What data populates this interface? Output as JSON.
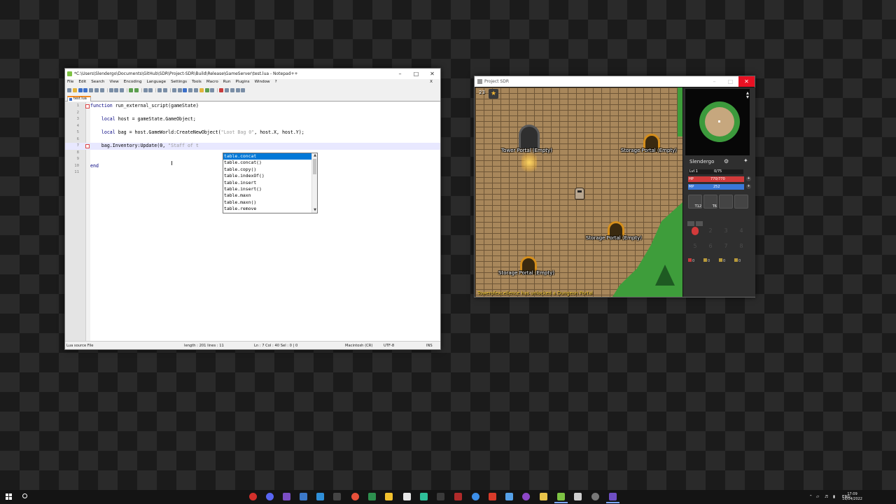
{
  "notepad": {
    "title": "*C:\\Users\\Slendergo\\Documents\\GitHub\\SDR\\Project-SDR\\Build\\Release\\GameServer\\test.lua - Notepad++",
    "menu": [
      "File",
      "Edit",
      "Search",
      "View",
      "Encoding",
      "Language",
      "Settings",
      "Tools",
      "Macro",
      "Run",
      "Plugins",
      "Window",
      "?"
    ],
    "close_x": "X",
    "tab_label": "test.lua",
    "code": [
      {
        "n": "1",
        "text": "function run_external_script(gameState)"
      },
      {
        "n": "2",
        "text": ""
      },
      {
        "n": "3",
        "text": "    local host = gameState.GameObject;"
      },
      {
        "n": "4",
        "text": ""
      },
      {
        "n": "5",
        "text": "    local bag = host.GameWorld:CreateNewObject(\"Loot Bag 0\", host.X, host.Y);"
      },
      {
        "n": "6",
        "text": ""
      },
      {
        "n": "7",
        "text": "    bag.Inventory:Update(0, \"Staff of t"
      },
      {
        "n": "8",
        "text": ""
      },
      {
        "n": "9",
        "text": ""
      },
      {
        "n": "10",
        "text": "end"
      },
      {
        "n": "11",
        "text": ""
      }
    ],
    "autocomplete": [
      "table.concat",
      "table.concat()",
      "table.copy()",
      "table.indexOf()",
      "table.insert",
      "table.insert()",
      "table.maxn",
      "table.maxn()",
      "table.remove"
    ],
    "status": {
      "file_type": "Lua source File",
      "length": "length : 201    lines : 11",
      "position": "Ln : 7    Col : 40    Sel : 0 | 0",
      "eol": "Macintosh (CR)",
      "encoding": "UTF-8",
      "mode": "INS"
    }
  },
  "game": {
    "title": "Project SDR",
    "level_badge": "23",
    "star": "★",
    "portals": {
      "tower": "Tower Portal (Empty)",
      "storage1": "Storage Portal (Empty)",
      "storage2": "Storage Portal (Empty)",
      "storage3": "Storage Portal (Empty)"
    },
    "chat": "Towerofexcellence has unlocked a Dungeon Portal",
    "panel": {
      "player_name": "Slendergo",
      "level_label": "Lvl 1",
      "xp_text": "0/75",
      "xp_fraction": 0.0,
      "hp_label": "HP",
      "hp_text": "770/770",
      "hp_fraction": 1.0,
      "mp_label": "MP",
      "mp_text": "252",
      "mp_fraction": 1.0,
      "plus": "+",
      "equip_tiers": [
        "T12",
        "T6",
        "",
        ""
      ],
      "inventory_slot_numbers": [
        "",
        "2",
        "3",
        "4",
        "5",
        "6",
        "7",
        "8"
      ],
      "quickslot_counts": [
        "0",
        "0",
        "0",
        "0"
      ]
    },
    "colors": {
      "hp": "#d23a3a",
      "mp": "#3a78d8",
      "grass": "#3e9d3b",
      "portal": "#d48e1c"
    }
  },
  "taskbar": {
    "tray_lang": "ENG",
    "time": "17:09",
    "date": "16/04/2022"
  }
}
